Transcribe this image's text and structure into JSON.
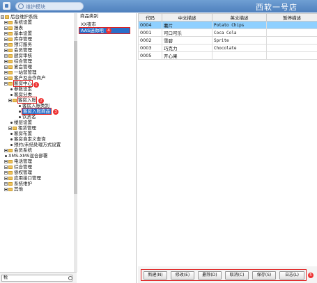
{
  "header": {
    "search_placeholder": "维护模块",
    "brand": "西软一号店"
  },
  "tree": {
    "items": [
      {
        "label": "后台维护系统"
      },
      {
        "label": "系统设置"
      },
      {
        "label": "报表"
      },
      {
        "label": "基本设置"
      },
      {
        "label": "库存管理"
      },
      {
        "label": "预订服务"
      },
      {
        "label": "会员管理"
      },
      {
        "label": "厨房审核"
      },
      {
        "label": "综合管理"
      },
      {
        "label": "宴会管理"
      },
      {
        "label": "一站营管理"
      },
      {
        "label": "客户及合作商户"
      },
      {
        "label": "客房中心"
      },
      {
        "label": "参数设定"
      },
      {
        "label": "客房分类"
      },
      {
        "label": "客房入账"
      },
      {
        "label": "客房入账类别"
      },
      {
        "label": "客房入账商品"
      },
      {
        "label": "饮货名"
      },
      {
        "label": "楼层设置"
      },
      {
        "label": "租赁管理"
      },
      {
        "label": "客房布置"
      },
      {
        "label": "客房自定义查询"
      },
      {
        "label": "预约/未结处理方式设置"
      },
      {
        "label": "会员系统"
      },
      {
        "label": "XMS-XMS混合部署"
      },
      {
        "label": "电话管理"
      },
      {
        "label": "综合管理"
      },
      {
        "label": "债权管理"
      },
      {
        "label": "应用接口管理"
      },
      {
        "label": "系统维护"
      },
      {
        "label": "其他"
      }
    ],
    "badges": [
      "1",
      "2",
      "3"
    ],
    "bottom_field": "税"
  },
  "category": {
    "title": "商品类别",
    "items": [
      {
        "label": "XX夜市"
      },
      {
        "label": "AAS迷你吧"
      }
    ],
    "badge": "4"
  },
  "grid": {
    "columns": [
      "代码",
      "中文描述",
      "英文描述",
      "暂停描述"
    ],
    "rows": [
      {
        "code": "0004",
        "cn": "薯片",
        "en": "Potato Chips",
        "pause": ""
      },
      {
        "code": "0001",
        "cn": "可口可乐",
        "en": "Coca Cola",
        "pause": ""
      },
      {
        "code": "0002",
        "cn": "雪碧",
        "en": "Sprite",
        "pause": ""
      },
      {
        "code": "0003",
        "cn": "巧克力",
        "en": "Chocolate",
        "pause": ""
      },
      {
        "code": "0005",
        "cn": "开心果",
        "en": "",
        "pause": ""
      }
    ]
  },
  "toolbar": {
    "new": "新建(N)",
    "edit": "修改(E)",
    "delete": "删除(D)",
    "cancel": "取消(C)",
    "save": "保存(S)",
    "log": "日志(L)",
    "badge": "5"
  },
  "colors": {
    "header": "#4f80bd",
    "selection": "#2a6fc9",
    "row_highlight": "#8fd0ff",
    "annotation": "#e02020"
  }
}
